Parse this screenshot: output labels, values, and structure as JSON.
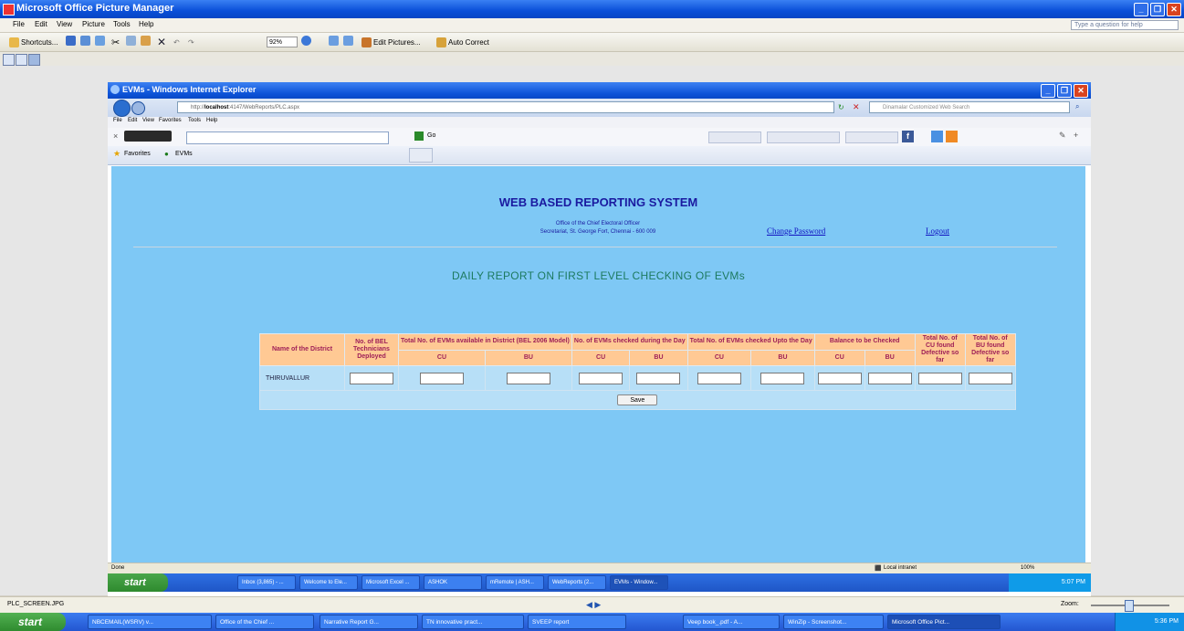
{
  "pm": {
    "title": "Microsoft Office Picture Manager",
    "menu": [
      "File",
      "Edit",
      "View",
      "Picture",
      "Tools",
      "Help"
    ],
    "help_placeholder": "Type a question for help",
    "toolbar": {
      "shortcuts": "Shortcuts...",
      "zoom": "92%",
      "edit_pictures": "Edit Pictures...",
      "auto_correct": "Auto Correct"
    },
    "status": {
      "filename": "PLC_SCREEN.JPG",
      "zoom_label": "Zoom:"
    }
  },
  "ie": {
    "title": "EVMs - Windows Internet Explorer",
    "url_prefix": "http://",
    "url_host": "localhost",
    "url_rest": ":4147/WebReports/PLC.aspx",
    "search_placeholder": "Dinamalar Customized Web Search",
    "menu": [
      "File",
      "Edit",
      "View",
      "Favorites",
      "Tools",
      "Help"
    ],
    "favorites_label": "Favorites",
    "tab_label": "EVMs",
    "go_label": "Go",
    "status_text": "Done",
    "zone_text": "Local intranet",
    "zoom_text": "100%"
  },
  "page": {
    "site_title": "WEB BASED REPORTING SYSTEM",
    "office_line1": "Office of the Chief Electoral Officer",
    "office_line2": "Secretariat, St. George Fort, Chennai - 600 009",
    "change_password": "Change Password",
    "logout": "Logout",
    "report_title": "DAILY REPORT ON FIRST LEVEL CHECKING OF EVMs",
    "table": {
      "headers": {
        "district": "Name of the District",
        "technicians": "No. of BEL Technicians Deployed",
        "available": "Total No. of EVMs available in District (BEL 2006 Model)",
        "checked_day": "No. of EVMs checked during the Day",
        "checked_upto": "Total No. of EVMs checked Upto the Day",
        "balance": "Balance to be Checked",
        "cu_defective": "Total No. of CU found Defective so far",
        "bu_defective": "Total No. of BU found Defective so far",
        "cu": "CU",
        "bu": "BU"
      },
      "row": {
        "district": "THIRUVALLUR"
      },
      "save_label": "Save"
    }
  },
  "inner_taskbar": {
    "start": "start",
    "tasks": [
      "Inbox (3,865) - ...",
      "Welcome to Ele...",
      "Microsoft Excel ...",
      "ASHOK",
      "mRemote | ASH...",
      "WebReports (2...",
      "EVMs - Window..."
    ],
    "clock": "5:07 PM"
  },
  "taskbar": {
    "start": "start",
    "tasks": [
      "NBCEMAIL(WSRV) v...",
      "Office of the Chief ...",
      "Narrative Report G...",
      "TN innovative pract...",
      "SVEEP report",
      "Veep book_.pdf - A...",
      "WinZip - Screenshot...",
      "Microsoft Office Pict..."
    ],
    "clock": "5:36 PM"
  }
}
